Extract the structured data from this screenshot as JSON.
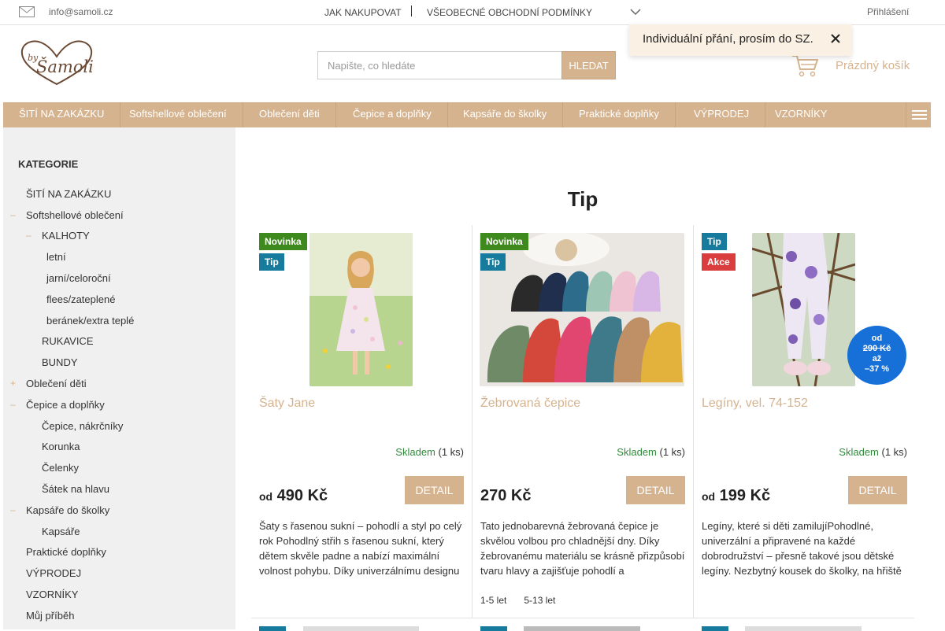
{
  "topbar": {
    "email": "info@samoli.cz",
    "nav": [
      "JAK NAKUPOVAT",
      "VŠEOBECNÉ OBCHODNÍ PODMÍNKY"
    ],
    "login": "Přihlášení"
  },
  "header": {
    "logo_text": "by Šamoli",
    "search_placeholder": "Napište, co hledáte",
    "search_button": "HLEDAT",
    "cart_label": "Prázdný košík"
  },
  "toast": {
    "text": "Individuální přání, prosím do SZ."
  },
  "menu": [
    "ŠITÍ NA ZAKÁZKU",
    "Softshellové oblečení",
    "Oblečení děti",
    "Čepice a doplňky",
    "Kapsáře do školky",
    "Praktické doplňky",
    "VÝPRODEJ",
    "VZORNÍKY"
  ],
  "sidebar": {
    "title": "KATEGORIE",
    "categories": [
      {
        "label": "ŠITÍ NA ZAKÁZKU",
        "marker": ""
      },
      {
        "label": "Softshellové oblečení",
        "marker": "–"
      },
      {
        "label": "KALHOTY",
        "marker": "–"
      },
      {
        "label": "letní",
        "marker": ""
      },
      {
        "label": "jarní/celoroční",
        "marker": ""
      },
      {
        "label": "flees/zateplené",
        "marker": ""
      },
      {
        "label": "beránek/extra teplé",
        "marker": ""
      },
      {
        "label": "RUKAVICE",
        "marker": ""
      },
      {
        "label": "BUNDY",
        "marker": ""
      },
      {
        "label": "Oblečení děti",
        "marker": "+"
      },
      {
        "label": "Čepice a doplňky",
        "marker": "–"
      },
      {
        "label": "Čepice, nákrčníky",
        "marker": ""
      },
      {
        "label": "Korunka",
        "marker": ""
      },
      {
        "label": "Čelenky",
        "marker": ""
      },
      {
        "label": "Šátek na hlavu",
        "marker": ""
      },
      {
        "label": "Kapsáře do školky",
        "marker": "–"
      },
      {
        "label": "Kapsáře",
        "marker": ""
      },
      {
        "label": "Praktické doplňky",
        "marker": ""
      },
      {
        "label": "VÝPRODEJ",
        "marker": ""
      },
      {
        "label": "VZORNÍKY",
        "marker": ""
      },
      {
        "label": "Můj příběh",
        "marker": ""
      }
    ]
  },
  "main": {
    "title": "Tip",
    "products": [
      {
        "badges": [
          "Novinka",
          "Tip"
        ],
        "name": "Šaty Jane",
        "stock_status": "Skladem",
        "stock_qty": "(1 ks)",
        "price_prefix": "od",
        "price": "490 Kč",
        "detail": "DETAIL",
        "description": "Šaty s řasenou sukní – pohodlí a styl po celý rok Pohodlný střih s řasenou sukní, který dětem skvěle padne a nabízí maximální volnost pohybu. Díky univerzálnímu designu"
      },
      {
        "badges": [
          "Novinka",
          "Tip"
        ],
        "name": "Žebrovaná čepice",
        "stock_status": "Skladem",
        "stock_qty": "(1 ks)",
        "price_prefix": "",
        "price": "270 Kč",
        "detail": "DETAIL",
        "description": "Tato jednobarevná žebrovaná čepice  je skvělou volbou pro chladnější dny. Díky žebrovanému materiálu se krásně přizpůsobí tvaru hlavy a zajišťuje pohodlí a",
        "sizes": [
          "1-5 let",
          "5-13 let"
        ]
      },
      {
        "badges": [
          "Tip",
          "Akce"
        ],
        "name": "Legíny, vel. 74-152",
        "stock_status": "Skladem",
        "stock_qty": "(1 ks)",
        "price_prefix": "od",
        "price": "199 Kč",
        "detail": "DETAIL",
        "description": "Legíny, které si děti zamilujíPohodlné, univerzální a připravené na každé dobrodružství – přesně takové jsou  dětské legíny. Nezbytný kousek do školky, na hřiště",
        "discount": {
          "from": "od",
          "old_price": "290 Kč",
          "to": "až",
          "percent": "–37 %"
        }
      }
    ]
  },
  "colors": {
    "accent": "#d6b38f",
    "badge_novinka": "#3f8a1e",
    "badge_tip": "#167b9c",
    "badge_akce": "#d93d3d",
    "stock": "#2e8b3a",
    "discount": "#1670d8"
  }
}
